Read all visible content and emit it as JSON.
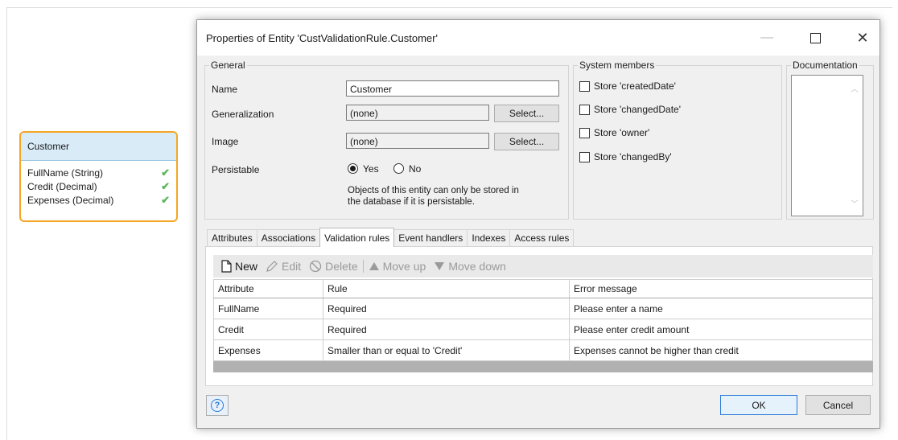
{
  "entity": {
    "name": "Customer",
    "attributes": [
      {
        "label": "FullName (String)"
      },
      {
        "label": "Credit (Decimal)"
      },
      {
        "label": "Expenses (Decimal)"
      }
    ]
  },
  "dialog": {
    "title": "Properties of Entity 'CustValidationRule.Customer'",
    "general": {
      "legend": "General",
      "name_label": "Name",
      "name_value": "Customer",
      "generalization_label": "Generalization",
      "generalization_value": "(none)",
      "image_label": "Image",
      "image_value": "(none)",
      "select_label": "Select...",
      "persistable_label": "Persistable",
      "yes_label": "Yes",
      "no_label": "No",
      "note_line1": "Objects of this entity can only be stored in",
      "note_line2": "the database if it is persistable."
    },
    "system_members": {
      "legend": "System members",
      "items": [
        "Store 'createdDate'",
        "Store 'changedDate'",
        "Store 'owner'",
        "Store 'changedBy'"
      ]
    },
    "documentation": {
      "legend": "Documentation"
    },
    "tabs": [
      "Attributes",
      "Associations",
      "Validation rules",
      "Event handlers",
      "Indexes",
      "Access rules"
    ],
    "active_tab": "Validation rules",
    "toolbar": {
      "new": "New",
      "edit": "Edit",
      "delete": "Delete",
      "move_up": "Move up",
      "move_down": "Move down"
    },
    "table": {
      "headers": [
        "Attribute",
        "Rule",
        "Error message"
      ],
      "rows": [
        [
          "FullName",
          "Required",
          "Please enter a name"
        ],
        [
          "Credit",
          "Required",
          "Please enter credit amount"
        ],
        [
          "Expenses",
          "Smaller than or equal to 'Credit'",
          "Expenses cannot be higher than credit"
        ]
      ]
    },
    "buttons": {
      "ok": "OK",
      "cancel": "Cancel",
      "help": "?"
    }
  },
  "colors": {
    "accent": "#f5a623",
    "entity_header": "#d8ebf7",
    "check": "#5cb85c",
    "primary_border": "#2a7ad6"
  }
}
